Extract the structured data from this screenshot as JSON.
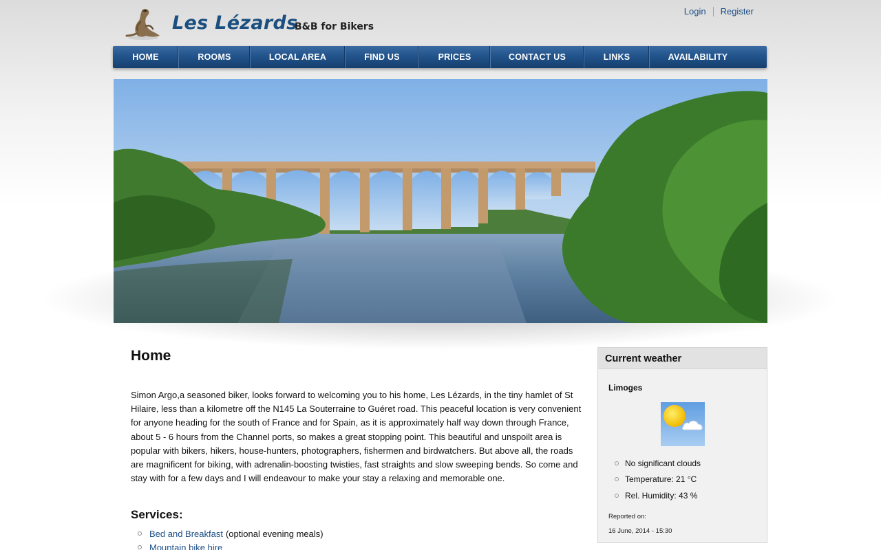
{
  "header": {
    "site_title": "Les Lézards",
    "tagline": "B&B for Bikers",
    "login_label": "Login",
    "register_label": "Register"
  },
  "nav": {
    "items": [
      {
        "label": "HOME"
      },
      {
        "label": "ROOMS"
      },
      {
        "label": "LOCAL AREA"
      },
      {
        "label": "FIND US"
      },
      {
        "label": "PRICES"
      },
      {
        "label": "CONTACT US"
      },
      {
        "label": "LINKS"
      },
      {
        "label": "AVAILABILITY"
      }
    ]
  },
  "main": {
    "title": "Home",
    "intro": "Simon Argo,a seasoned biker, looks forward to welcoming you to his home, Les Lézards, in the tiny hamlet of St Hilaire, less than a kilometre off the N145 La Souterraine to Guéret road. This peaceful location is very convenient for anyone heading for the south of France and for Spain, as it is approximately half way down through France, about 5 - 6 hours from the Channel ports, so makes a great stopping point. This beautiful and unspoilt area is popular with bikers, hikers, house-hunters, photographers, fishermen and birdwatchers. But above all, the roads are magnificent for biking, with adrenalin-boosting twisties, fast straights and slow sweeping bends. So come and stay with for a few days and I will endeavour to make your stay a relaxing and memorable one.",
    "services_title": "Services:",
    "services": [
      {
        "link": "Bed and Breakfast",
        "note": "(optional evening meals)"
      },
      {
        "link": "Mountain bike hire",
        "note": ""
      }
    ]
  },
  "weather": {
    "title": "Current weather",
    "city": "Limoges",
    "conditions": "No significant clouds",
    "temperature": "Temperature: 21 °C",
    "humidity": "Rel. Humidity: 43 %",
    "reported_label": "Reported on:",
    "reported_date": "16 June, 2014 - 15:30",
    "icon": "sun-cloud-icon"
  },
  "colors": {
    "brand": "#1b4f7f",
    "nav": "#22548c",
    "link": "#1d4e85"
  }
}
